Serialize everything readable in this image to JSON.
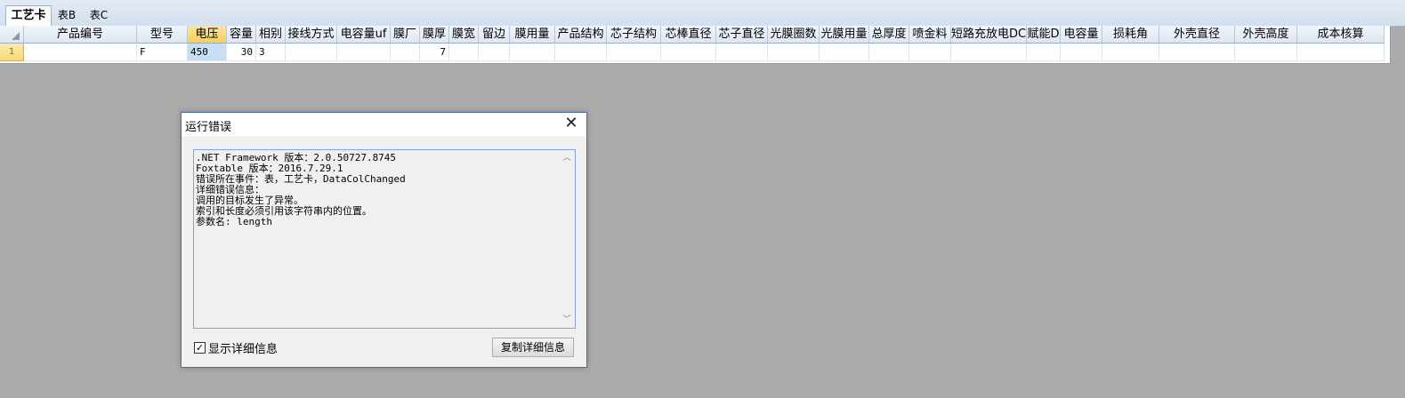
{
  "tabs": [
    {
      "label": "工艺卡",
      "active": true
    },
    {
      "label": "表B",
      "active": false
    },
    {
      "label": "表C",
      "active": false
    }
  ],
  "grid": {
    "columns": [
      "产品编号",
      "型号",
      "电压",
      "容量",
      "相别",
      "接线方式",
      "电容量uf",
      "膜厂",
      "膜厚",
      "膜宽",
      "留边",
      "膜用量",
      "产品结构",
      "芯子结构",
      "芯棒直径",
      "芯子直径",
      "光膜圈数",
      "光膜用量",
      "总厚度",
      "喷金料",
      "短路充放电DC",
      "赋能D",
      "电容量",
      "损耗角",
      "外壳直径",
      "外壳高度",
      "成本核算"
    ],
    "selected_column": "电压",
    "rows": [
      {
        "row_number": "1",
        "cells": [
          "",
          "F",
          "450",
          "30",
          "3",
          "",
          "",
          "",
          "7",
          "",
          "",
          "",
          "",
          "",
          "",
          "",
          "",
          "",
          "",
          "",
          "",
          "",
          "",
          "",
          "",
          "",
          ""
        ]
      }
    ]
  },
  "dialog": {
    "title": "运行错误",
    "details_lines": [
      ".NET Framework 版本：2.0.50727.8745",
      "Foxtable 版本：2016.7.29.1",
      "错误所在事件：表，工艺卡，DataColChanged",
      "详细错误信息：",
      "调用的目标发生了异常。",
      "索引和长度必须引用该字符串内的位置。",
      "参数名: length"
    ],
    "checkbox_label": "显示详细信息",
    "checkbox_checked": true,
    "copy_button_label": "复制详细信息"
  }
}
